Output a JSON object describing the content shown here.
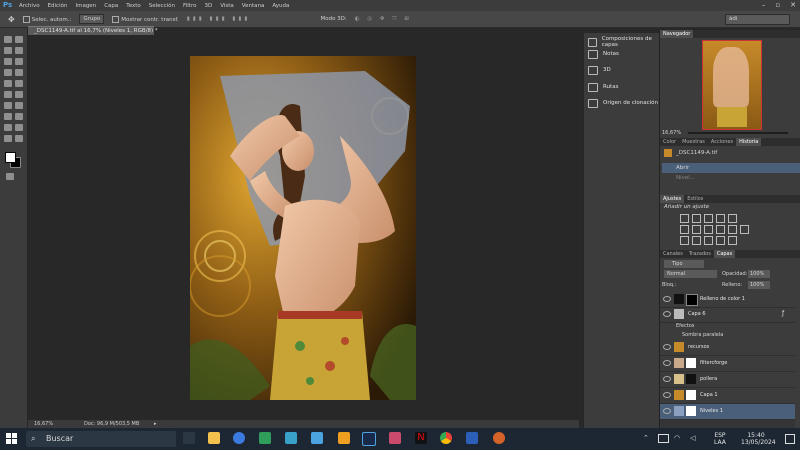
{
  "app": {
    "logo": "Ps"
  },
  "menu": [
    "Archivo",
    "Edición",
    "Imagen",
    "Capa",
    "Texto",
    "Selección",
    "Filtro",
    "3D",
    "Vista",
    "Ventana",
    "Ayuda"
  ],
  "options": {
    "auto_select_label": "Selec. autom.:",
    "auto_select_value": "Grupo",
    "transform_label": "Mostrar contr. transf.",
    "mode_3d_label": "Modo 3D:",
    "workspace_value": "ádi"
  },
  "document": {
    "tab_title": "_DSC1149-A.tif al 16,7% (Niveles 1, RGB/8) *",
    "zoom": "16,67%",
    "doc_size": "Doc: 96,9 M/503,5 MB"
  },
  "dock": {
    "items": [
      "Composiciones de capas",
      "Notas",
      "3D",
      "Rutas",
      "Origen de clonación"
    ]
  },
  "navigator": {
    "tab": "Navegador",
    "zoom": "16,67%"
  },
  "history": {
    "tabs": [
      "Color",
      "Muestras",
      "Acciones",
      "Historia"
    ],
    "snapshot": "_DSC1149-A.tif",
    "steps": [
      "Abrir",
      "Nivel..."
    ]
  },
  "adjustments": {
    "tabs": [
      "Ajustes",
      "Estilos"
    ],
    "heading": "Añadir un ajuste"
  },
  "layers_panel": {
    "tabs": [
      "Canales",
      "Trazados",
      "Capas"
    ],
    "filter_label": "Tipo",
    "blend_mode": "Normal",
    "opacity_label": "Opacidad:",
    "opacity_value": "100%",
    "lock_label": "Bloq.:",
    "fill_label": "Relleno:",
    "fill_value": "100%",
    "layers": [
      {
        "name": "Relleno de color 1"
      },
      {
        "name": "Capa 6"
      },
      {
        "name": "Efectos"
      },
      {
        "name": "Sombra paralela"
      },
      {
        "name": "recursos"
      },
      {
        "name": "filtercforge"
      },
      {
        "name": "pollera"
      },
      {
        "name": "Capa 1"
      },
      {
        "name": "Niveles 1"
      }
    ]
  },
  "taskbar": {
    "search_placeholder": "Buscar",
    "lang_top": "ESP",
    "lang_bottom": "LAA",
    "time": "15:40",
    "date": "13/05/2024"
  },
  "colors": {
    "accent": "#4fa3e0",
    "selected_row": "#4a5f7a",
    "panel_bg": "#3c3c3c",
    "workspace_bg": "#282828"
  }
}
